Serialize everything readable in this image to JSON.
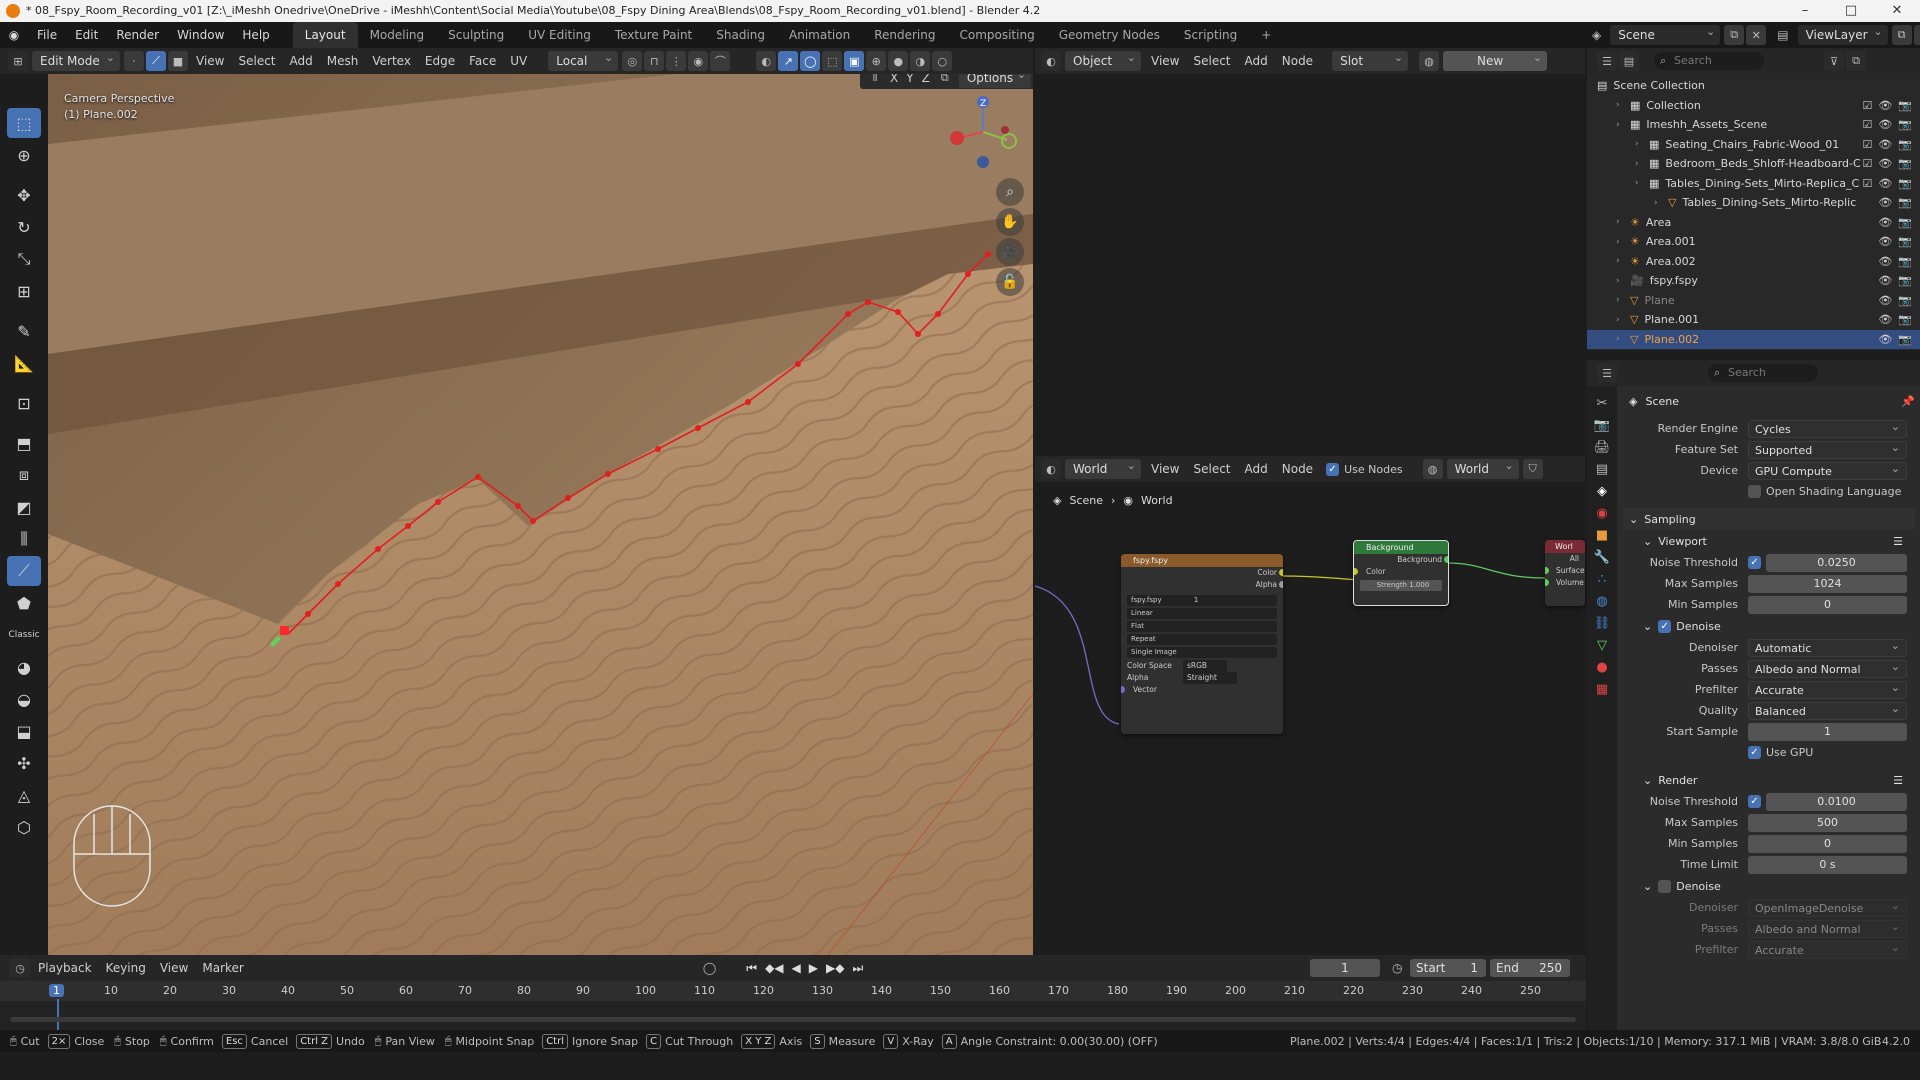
{
  "titlebar": {
    "text": "* 08_Fspy_Room_Recording_v01 [Z:\\_iMeshh Onedrive\\OneDrive - iMeshh\\Content\\Social Media\\Youtube\\08_Fspy Dining Area\\Blends\\08_Fspy_Room_Recording_v01.blend] - Blender 4.2"
  },
  "menu": [
    "File",
    "Edit",
    "Render",
    "Window",
    "Help"
  ],
  "workspaces": [
    "Layout",
    "Modeling",
    "Sculpting",
    "UV Editing",
    "Texture Paint",
    "Shading",
    "Animation",
    "Rendering",
    "Compositing",
    "Geometry Nodes",
    "Scripting"
  ],
  "active_workspace": "Layout",
  "scene_name": "Scene",
  "view_layer": "ViewLayer",
  "viewport": {
    "mode": "Edit Mode",
    "menus": [
      "View",
      "Select",
      "Add",
      "Mesh",
      "Vertex",
      "Edge",
      "Face",
      "UV"
    ],
    "transform_orientation": "Local",
    "camera_label": "Camera Perspective",
    "object_label": "(1) Plane.002",
    "axis_labels": [
      "X",
      "Y",
      "Z"
    ],
    "options_label": "Options",
    "gizmo_z": "Z"
  },
  "shader_editor": {
    "object_dd": "Object",
    "menus": [
      "View",
      "Select",
      "Add",
      "Node"
    ],
    "slot": "Slot",
    "new_label": "New"
  },
  "world_editor": {
    "world_dd": "World",
    "menus": [
      "View",
      "Select",
      "Add",
      "Node"
    ],
    "use_nodes": "Use Nodes",
    "world_name": "World",
    "breadcrumb": [
      "Scene",
      "World"
    ],
    "node_image": {
      "title": "fspy.fspy",
      "outputs": [
        "Color",
        "Alpha"
      ],
      "image_name": "fspy.fspy",
      "users": "1",
      "interpolation": "Linear",
      "projection": "Flat",
      "extension": "Repeat",
      "source": "Single Image",
      "color_space_label": "Color Space",
      "color_space": "sRGB",
      "alpha_label": "Alpha",
      "alpha": "Straight",
      "input": "Vector"
    },
    "node_background": {
      "title": "Background",
      "output": "Background",
      "color": "Color",
      "strength_label": "Strength",
      "strength": "1.000"
    },
    "node_output": {
      "title": "Worl",
      "target": "All",
      "inputs": [
        "Surface",
        "Volume"
      ]
    }
  },
  "outliner": {
    "search_placeholder": "Search",
    "rows": [
      {
        "label": "Scene Collection",
        "indent": 0,
        "type": "scene"
      },
      {
        "label": "Collection",
        "indent": 1,
        "type": "collection"
      },
      {
        "label": "Imeshh_Assets_Scene",
        "indent": 1,
        "type": "collection"
      },
      {
        "label": "Seating_Chairs_Fabric-Wood_01",
        "indent": 2,
        "type": "collection"
      },
      {
        "label": "Bedroom_Beds_Shloff-Headboard-C",
        "indent": 2,
        "type": "collection"
      },
      {
        "label": "Tables_Dining-Sets_Mirto-Replica_C",
        "indent": 2,
        "type": "collection"
      },
      {
        "label": "Tables_Dining-Sets_Mirto-Replic",
        "indent": 3,
        "type": "object"
      },
      {
        "label": "Area",
        "indent": 1,
        "type": "light"
      },
      {
        "label": "Area.001",
        "indent": 1,
        "type": "light"
      },
      {
        "label": "Area.002",
        "indent": 1,
        "type": "light"
      },
      {
        "label": "fspy.fspy",
        "indent": 1,
        "type": "camera"
      },
      {
        "label": "Plane",
        "indent": 1,
        "type": "mesh"
      },
      {
        "label": "Plane.001",
        "indent": 1,
        "type": "mesh"
      },
      {
        "label": "Plane.002",
        "indent": 1,
        "type": "mesh"
      }
    ]
  },
  "properties": {
    "search_placeholder": "Search",
    "context": "Scene",
    "render_engine_label": "Render Engine",
    "render_engine": "Cycles",
    "feature_set_label": "Feature Set",
    "feature_set": "Supported",
    "device_label": "Device",
    "device": "GPU Compute",
    "osl_label": "Open Shading Language",
    "sampling": "Sampling",
    "viewport": "Viewport",
    "vp_noise_label": "Noise Threshold",
    "vp_noise": "0.0250",
    "vp_max_label": "Max Samples",
    "vp_max": "1024",
    "vp_min_label": "Min Samples",
    "vp_min": "0",
    "denoise": "Denoise",
    "denoiser_label": "Denoiser",
    "denoiser": "Automatic",
    "passes_label": "Passes",
    "passes": "Albedo and Normal",
    "prefilter_label": "Prefilter",
    "prefilter": "Accurate",
    "quality_label": "Quality",
    "quality": "Balanced",
    "start_sample_label": "Start Sample",
    "start_sample": "1",
    "use_gpu": "Use GPU",
    "render": "Render",
    "r_noise_label": "Noise Threshold",
    "r_noise": "0.0100",
    "r_max_label": "Max Samples",
    "r_max": "500",
    "r_min_label": "Min Samples",
    "r_min": "0",
    "time_limit_label": "Time Limit",
    "time_limit": "0 s",
    "r_denoise": "Denoise",
    "r_denoiser_label": "Denoiser",
    "r_denoiser": "OpenImageDenoise",
    "r_passes_label": "Passes",
    "r_passes": "Albedo and Normal",
    "r_prefilter_label": "Prefilter",
    "r_prefilter": "Accurate"
  },
  "timeline": {
    "menus": [
      "Playback",
      "Keying",
      "View",
      "Marker"
    ],
    "current_frame": "1",
    "start_label": "Start",
    "start": "1",
    "end_label": "End",
    "end": "250",
    "ticks": [
      "1",
      "10",
      "20",
      "30",
      "40",
      "50",
      "60",
      "70",
      "80",
      "90",
      "100",
      "110",
      "120",
      "130",
      "140",
      "150",
      "160",
      "170",
      "180",
      "190",
      "200",
      "210",
      "220",
      "230",
      "240",
      "250"
    ]
  },
  "statusbar": {
    "items": [
      {
        "key": "",
        "label": "Cut"
      },
      {
        "key": "2×",
        "label": "Close"
      },
      {
        "key": "",
        "label": "Stop"
      },
      {
        "key": "",
        "label": "Confirm"
      },
      {
        "key": "Esc",
        "label": "Cancel"
      },
      {
        "key": "Ctrl Z",
        "label": "Undo"
      },
      {
        "key": "",
        "label": "Pan View"
      },
      {
        "key": "",
        "label": "Midpoint Snap"
      },
      {
        "key": "Ctrl",
        "label": "Ignore Snap"
      },
      {
        "key": "C",
        "label": "Cut Through"
      },
      {
        "key": "X Y Z",
        "label": "Axis"
      },
      {
        "key": "S",
        "label": "Measure"
      },
      {
        "key": "V",
        "label": "X-Ray"
      },
      {
        "key": "A",
        "label": "Angle Constraint: 0.00(30.00) (OFF)"
      }
    ],
    "stats": "Plane.002 | Verts:4/4 | Edges:4/4 | Faces:1/1 | Tris:2 | Objects:1/10 | Memory: 317.1 MiB | VRAM: 3.8/8.0 GiB",
    "version": "4.2.0"
  }
}
